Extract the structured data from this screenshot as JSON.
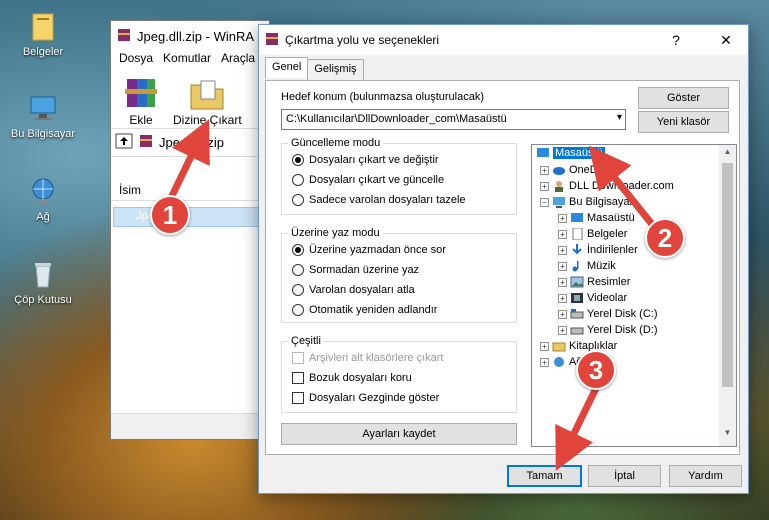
{
  "desktop": {
    "icons": [
      {
        "label": "Belgeler"
      },
      {
        "label": "Bu Bilgisayar"
      },
      {
        "label": "Ağ"
      },
      {
        "label": "Çöp Kutusu"
      }
    ]
  },
  "winrar": {
    "title": "Jpeg.dll.zip - WinRA",
    "menu": [
      "Dosya",
      "Komutlar",
      "Araçla"
    ],
    "toolbar": {
      "add_label": "Ekle",
      "extract_label": "Dizine Çıkart"
    },
    "path": "Jpeg.dll.zip",
    "column_name": "İsim",
    "selected_file": "Jpe"
  },
  "dialog": {
    "title": "Çıkartma yolu ve seçenekleri",
    "close_glyph": "✕",
    "help_glyph": "?",
    "tabs": [
      "Genel",
      "Gelişmiş"
    ],
    "dest_label": "Hedef konum (bulunmazsa oluşturulacak)",
    "dest_value": "C:\\Kullanıcılar\\DllDownloader_com\\Masaüstü",
    "show_btn": "Göster",
    "new_folder_btn": "Yeni klasör",
    "update_mode": {
      "title": "Güncelleme modu",
      "options": [
        "Dosyaları çıkart ve değiştir",
        "Dosyaları çıkart ve güncelle",
        "Sadece varolan dosyaları tazele"
      ],
      "selected": 0
    },
    "overwrite_mode": {
      "title": "Üzerine yaz modu",
      "options": [
        "Üzerine yazmadan önce sor",
        "Sormadan üzerine yaz",
        "Varolan dosyaları atla",
        "Otomatik yeniden adlandır"
      ],
      "selected": 0
    },
    "misc": {
      "title": "Çeşitli",
      "options": [
        "Arşivleri alt klasörlere çıkart",
        "Bozuk dosyaları koru",
        "Dosyaları Gezginde göster"
      ]
    },
    "save_btn": "Ayarları kaydet",
    "tree": [
      {
        "label": "Masaüstü",
        "selected": true
      },
      {
        "label": "OneDrive"
      },
      {
        "label": "DLL Downloader.com"
      },
      {
        "label": "Bu Bilgisayar"
      },
      {
        "label": "Masaüstü"
      },
      {
        "label": "Belgeler"
      },
      {
        "label": "İndirilenler"
      },
      {
        "label": "Müzik"
      },
      {
        "label": "Resimler"
      },
      {
        "label": "Videolar"
      },
      {
        "label": "Yerel Disk (C:)"
      },
      {
        "label": "Yerel Disk (D:)"
      },
      {
        "label": "Kitaplıklar"
      },
      {
        "label": "Ağ"
      }
    ],
    "ok_btn": "Tamam",
    "cancel_btn": "İptal",
    "help_btn": "Yardım"
  },
  "annotations": {
    "step1": "1",
    "step2": "2",
    "step3": "3",
    "color": "#e0443a"
  }
}
